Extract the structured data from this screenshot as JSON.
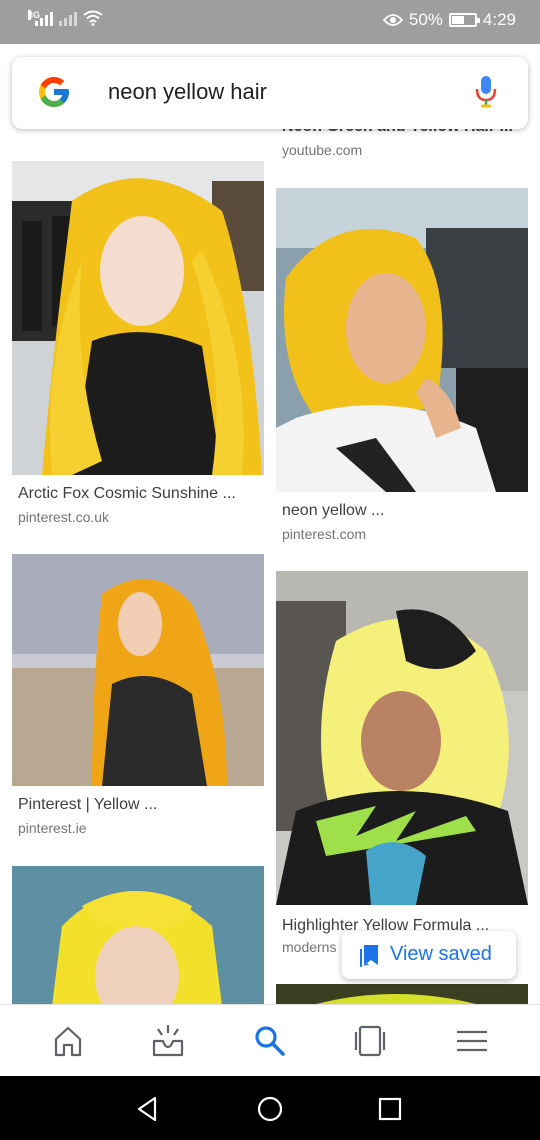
{
  "status_bar": {
    "network_tag": "3G",
    "battery_percent": "50%",
    "battery_level": 0.5,
    "time": "4:29",
    "icons": [
      "signal-icon",
      "no-sim-signal-icon",
      "wifi-icon",
      "eye-comfort-icon",
      "battery-icon"
    ]
  },
  "search": {
    "query": "neon yellow hair",
    "logo": "google-g-icon",
    "voice_icon": "microphone-icon"
  },
  "results": {
    "partial_top_title": "Neon Green and Yellow Hair ...",
    "partial_top_source": "youtube.com",
    "items": [
      {
        "title": "Arctic Fox Cosmic Sunshine ...",
        "source": "pinterest.co.uk"
      },
      {
        "title": "neon yellow ...",
        "source": "pinterest.com"
      },
      {
        "title": "Pinterest | Yellow ...",
        "source": "pinterest.ie"
      },
      {
        "title": "Highlighter Yellow Formula ...",
        "source": "moderns"
      }
    ]
  },
  "view_saved": {
    "label": "View saved",
    "icon": "bookmarks-icon",
    "color": "#1a73e8"
  },
  "bottom_nav": {
    "items": [
      "home-icon",
      "updates-icon",
      "search-icon",
      "tabs-icon",
      "menu-icon"
    ],
    "active": "search-icon",
    "active_color": "#1a73e8"
  },
  "system_nav": {
    "items": [
      "back-icon",
      "home-circle-icon",
      "recents-icon"
    ]
  }
}
